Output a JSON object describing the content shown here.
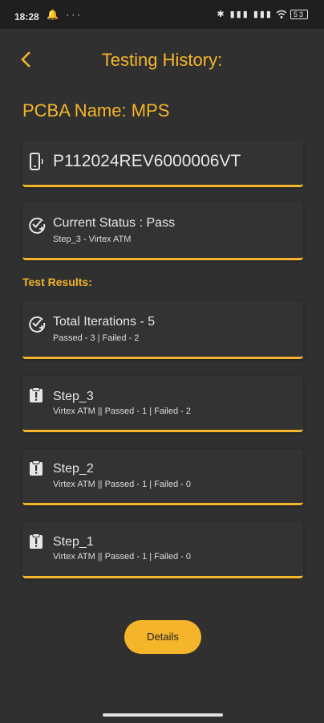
{
  "status_bar": {
    "time": "18:28",
    "left_icons": "🔔 ···",
    "right_icons": "✱ ▮▮▮ ▮▮▮",
    "battery": "53"
  },
  "header": {
    "title": "Testing History:"
  },
  "pcba": {
    "label": "PCBA Name: MPS"
  },
  "device": {
    "serial": "P112024REV6000006VT"
  },
  "current_status": {
    "title": "Current Status : Pass",
    "subtitle": "Step_3 - Virtex ATM"
  },
  "section": {
    "title": "Test Results:"
  },
  "total": {
    "title": "Total Iterations - 5",
    "subtitle": "Passed - 3 | Failed - 2"
  },
  "steps": [
    {
      "title": "Step_3",
      "subtitle": "Virtex ATM || Passed -  1 | Failed - 2"
    },
    {
      "title": "Step_2",
      "subtitle": "Virtex ATM || Passed -  1 | Failed - 0"
    },
    {
      "title": "Step_1",
      "subtitle": "Virtex ATM || Passed -  1 | Failed - 0"
    }
  ],
  "actions": {
    "details_label": "Details"
  },
  "colors": {
    "accent": "#f5b52a",
    "background": "#303030",
    "card": "#333333"
  }
}
